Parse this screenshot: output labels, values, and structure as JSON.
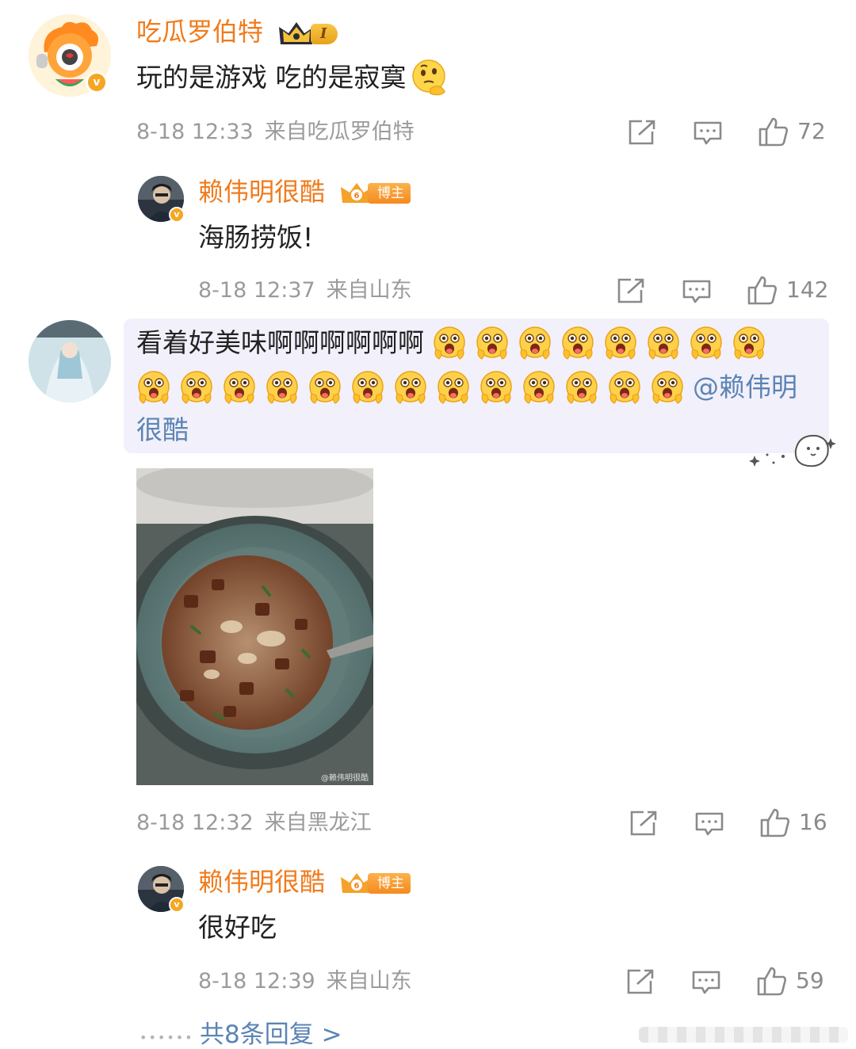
{
  "comments": [
    {
      "username": "吃瓜罗伯特",
      "level_badge": "I",
      "text": "玩的是游戏 吃的是寂寞",
      "text_emoji": "thinking-face-icon",
      "time": "8-18 12:33",
      "source": "来自吃瓜罗伯特",
      "likes": "72",
      "replies": [
        {
          "username": "赖伟明很酷",
          "badge": "博主",
          "text": "海肠捞饭!",
          "time": "8-18 12:37",
          "source": "来自山东",
          "likes": "142"
        }
      ]
    },
    {
      "text_prefix": "看着好美味啊啊啊啊啊啊",
      "emoji_icon": "drooling-face-icon",
      "emoji_count_line1": 8,
      "emoji_count_line2": 13,
      "mention_part1": "@赖伟明",
      "mention_part2": "很酷",
      "photo_watermark": "@赖伟明很酷",
      "time": "8-18 12:32",
      "source": "来自黑龙江",
      "likes": "16",
      "replies": [
        {
          "username": "赖伟明很酷",
          "badge": "博主",
          "text": "很好吃",
          "time": "8-18 12:39",
          "source": "来自山东",
          "likes": "59"
        }
      ]
    }
  ],
  "more_replies": "共8条回复 >",
  "colors": {
    "username": "#f07b1c",
    "link": "#5b84b5",
    "meta": "#9b9b9b",
    "highlight_bg": "#f2f0fa"
  }
}
